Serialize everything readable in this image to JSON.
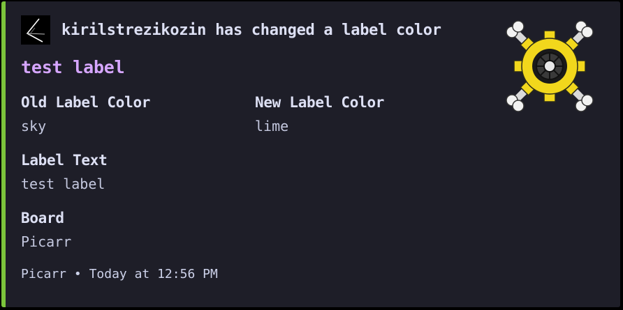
{
  "embed": {
    "accent_color": "#7cc43b",
    "author": {
      "text": "kirilstrezikozin has changed a label color"
    },
    "title": "test label",
    "fields": {
      "old_color": {
        "name": "Old Label Color",
        "value": "sky"
      },
      "new_color": {
        "name": "New Label Color",
        "value": "lime"
      },
      "label_text": {
        "name": "Label Text",
        "value": "test label"
      },
      "board": {
        "name": "Board",
        "value": "Picarr"
      }
    },
    "footer": {
      "source": "Picarr",
      "separator": "•",
      "timestamp": "Today at 12:56 PM"
    },
    "thumbnail": {
      "icon": "skull-crossbones-gear-logo-icon"
    }
  }
}
